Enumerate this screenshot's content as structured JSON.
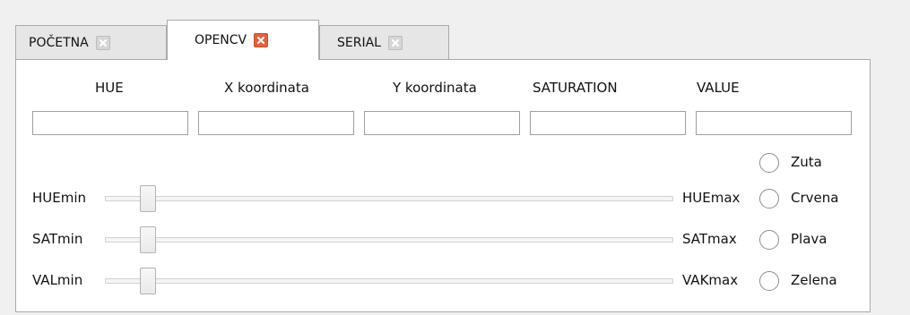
{
  "tabs": [
    {
      "label": "POČETNA",
      "active": false
    },
    {
      "label": "OPENCV",
      "active": true
    },
    {
      "label": "SERIAL",
      "active": false
    }
  ],
  "fields": [
    {
      "label": "HUE",
      "value": ""
    },
    {
      "label": "X koordinata",
      "value": ""
    },
    {
      "label": "Y koordinata",
      "value": ""
    },
    {
      "label": "SATURATION",
      "value": ""
    },
    {
      "label": "VALUE",
      "value": ""
    }
  ],
  "sliders": [
    {
      "min_label": "HUEmin",
      "max_label": "HUEmax",
      "level": 0.0
    },
    {
      "min_label": "SATmin",
      "max_label": "SATmax",
      "level": 0.0
    },
    {
      "min_label": "VALmin",
      "max_label": "VAKmax",
      "level": 0.0
    }
  ],
  "radio_options": [
    {
      "label": "Zuta",
      "checked": false
    },
    {
      "label": "Crvena",
      "checked": false
    },
    {
      "label": "Plava",
      "checked": false
    },
    {
      "label": "Zelena",
      "checked": false
    }
  ],
  "colors": {
    "active_close_bg": "#e26140",
    "inactive_close_bg": "#d6d6d6"
  }
}
